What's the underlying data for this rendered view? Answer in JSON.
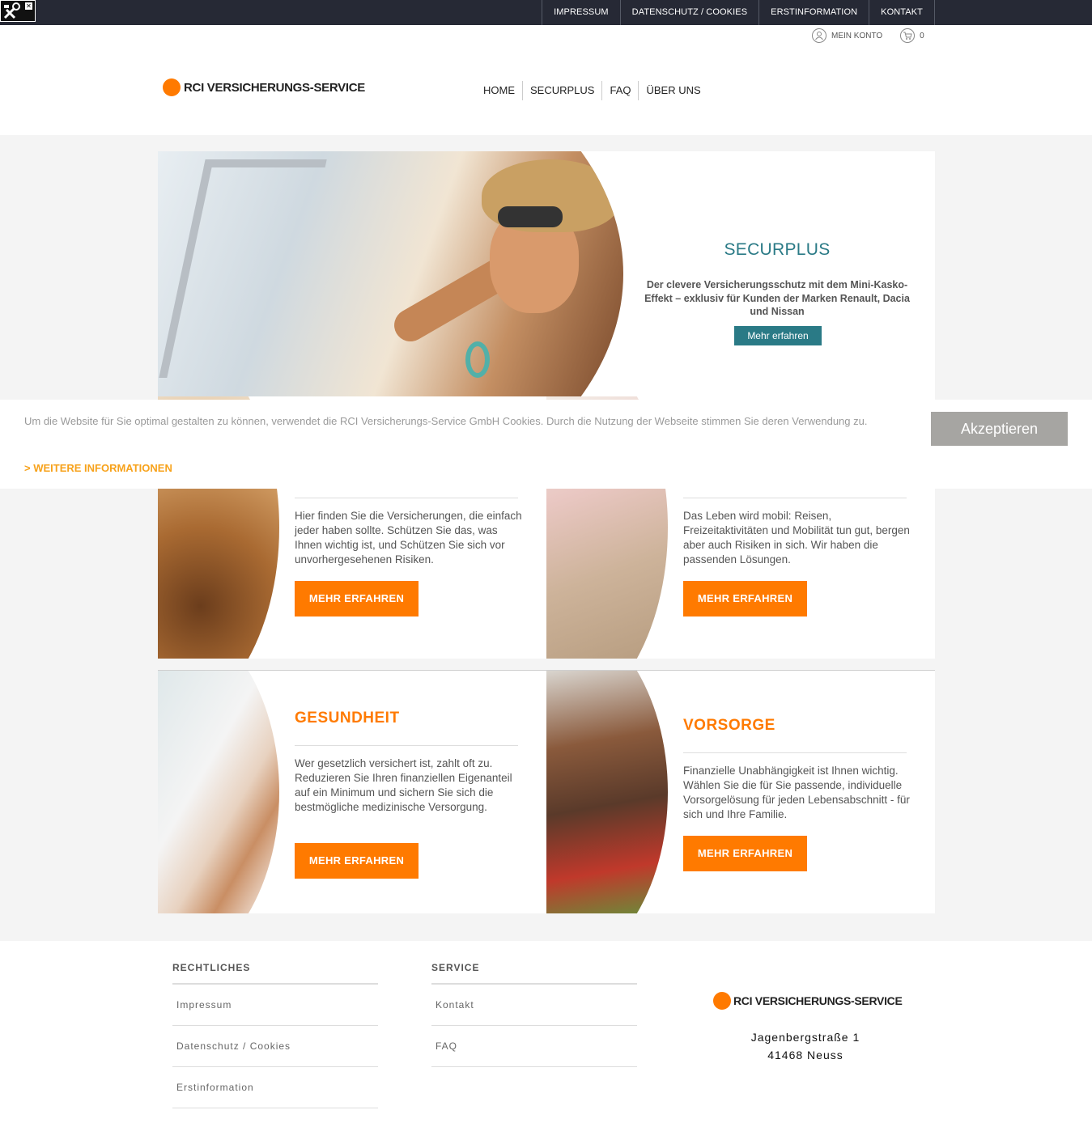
{
  "topbar": {
    "links": [
      "IMPRESSUM",
      "DATENSCHUTZ / COOKIES",
      "ERSTINFORMATION",
      "KONTAKT"
    ]
  },
  "account": {
    "label": "MEIN KONTO",
    "cart_count": "0"
  },
  "header": {
    "logo_text": "RCI VERSICHERUNGS-SERVICE",
    "nav": [
      "HOME",
      "SECURPLUS",
      "FAQ",
      "ÜBER UNS"
    ]
  },
  "hero": {
    "title": "SECURPLUS",
    "text": "Der clevere Versicherungsschutz mit dem Mini-Kasko-Effekt – exklusiv für Kunden der Marken Renault, Dacia und Nissan",
    "button": "Mehr erfahren"
  },
  "cookie": {
    "text": "Um die Website für Sie optimal gestalten zu können, verwendet die RCI Versicherungs-Service GmbH Cookies. Durch die Nutzung der Webseite stimmen Sie deren Verwendung zu.",
    "more": "> WEITERE INFORMATIONEN",
    "accept": "Akzeptieren"
  },
  "tiles": [
    {
      "title": "",
      "text": "Hier finden Sie die Versicherungen, die einfach jeder haben sollte. Schützen Sie das, was Ihnen wichtig ist, und Schützen Sie sich vor unvorhergesehenen Risiken.",
      "button": "MEHR ERFAHREN"
    },
    {
      "title": "",
      "text": "Das Leben wird mobil: Reisen, Freizeitaktivitäten und Mobilität tun gut, bergen aber auch Risiken in sich. Wir haben die passenden Lösungen.",
      "button": "MEHR ERFAHREN"
    },
    {
      "title": "GESUNDHEIT",
      "text": "Wer gesetzlich versichert ist, zahlt oft zu. Reduzieren Sie Ihren finanziellen Eigenanteil auf ein Minimum und sichern Sie sich die bestmögliche medizinische Versorgung.",
      "button": "MEHR ERFAHREN"
    },
    {
      "title": "VORSORGE",
      "text": "Finanzielle Unabhängigkeit ist Ihnen wichtig. Wählen Sie die für Sie passende, individuelle Vorsorgelösung für jeden Lebensabschnitt - für sich und Ihre Familie.",
      "button": "MEHR ERFAHREN"
    }
  ],
  "footer": {
    "col1": {
      "heading": "RECHTLICHES",
      "links": [
        "Impressum",
        "Datenschutz / Cookies",
        "Erstinformation"
      ]
    },
    "col2": {
      "heading": "SERVICE",
      "links": [
        "Kontakt",
        "FAQ"
      ]
    },
    "logo_text": "RCI VERSICHERUNGS-SERVICE",
    "address_line1": "Jagenbergstraße 1",
    "address_line2": "41468 Neuss"
  },
  "colors": {
    "accent": "#ff7a00",
    "teal": "#2a7a86",
    "topbar": "#262935",
    "cookie_link": "#f7a21b"
  },
  "icons": [
    "tools-icon",
    "user-icon",
    "cart-icon"
  ]
}
